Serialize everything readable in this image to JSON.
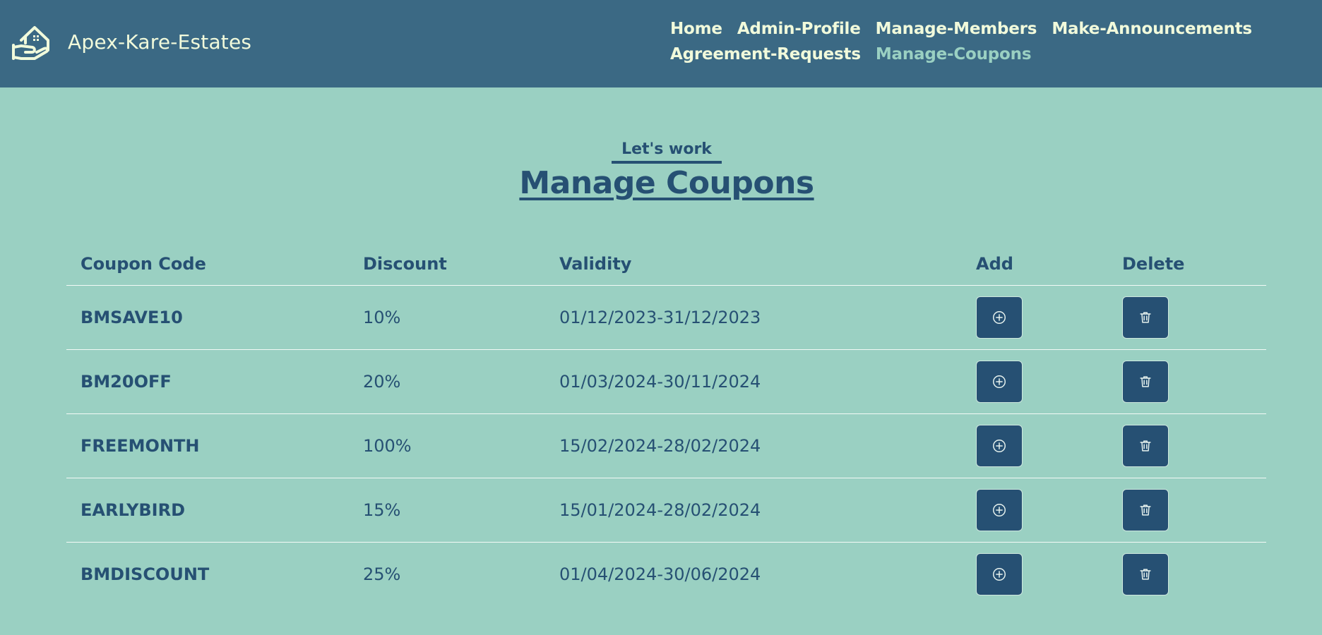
{
  "brand": {
    "name": "Apex-Kare-Estates",
    "logo_icon": "house-hand-icon"
  },
  "nav": {
    "links": [
      {
        "label": "Home",
        "active": false
      },
      {
        "label": "Admin-Profile",
        "active": false
      },
      {
        "label": "Manage-Members",
        "active": false
      },
      {
        "label": "Make-Announcements",
        "active": false
      },
      {
        "label": "Agreement-Requests",
        "active": false
      },
      {
        "label": "Manage-Coupons",
        "active": true
      }
    ]
  },
  "heading": {
    "subtitle": "Let's work",
    "title": "Manage Coupons"
  },
  "table": {
    "headers": [
      "Coupon Code",
      "Discount",
      "Validity",
      "Add",
      "Delete"
    ],
    "rows": [
      {
        "code": "BMSAVE10",
        "discount": "10%",
        "validity": "01/12/2023-31/12/2023"
      },
      {
        "code": "BM20OFF",
        "discount": "20%",
        "validity": "01/03/2024-30/11/2024"
      },
      {
        "code": "FREEMONTH",
        "discount": "100%",
        "validity": "15/02/2024-28/02/2024"
      },
      {
        "code": "EARLYBIRD",
        "discount": "15%",
        "validity": "15/01/2024-28/02/2024"
      },
      {
        "code": "BMDISCOUNT",
        "discount": "25%",
        "validity": "01/04/2024-30/06/2024"
      }
    ],
    "add_icon": "plus-circle-icon",
    "delete_icon": "trash-icon"
  },
  "colors": {
    "navbar_bg": "#3b6984",
    "page_bg": "#9ad0c2",
    "nav_text": "#f1fadb",
    "nav_active": "#9ad0c2",
    "primary_dark": "#265073"
  }
}
